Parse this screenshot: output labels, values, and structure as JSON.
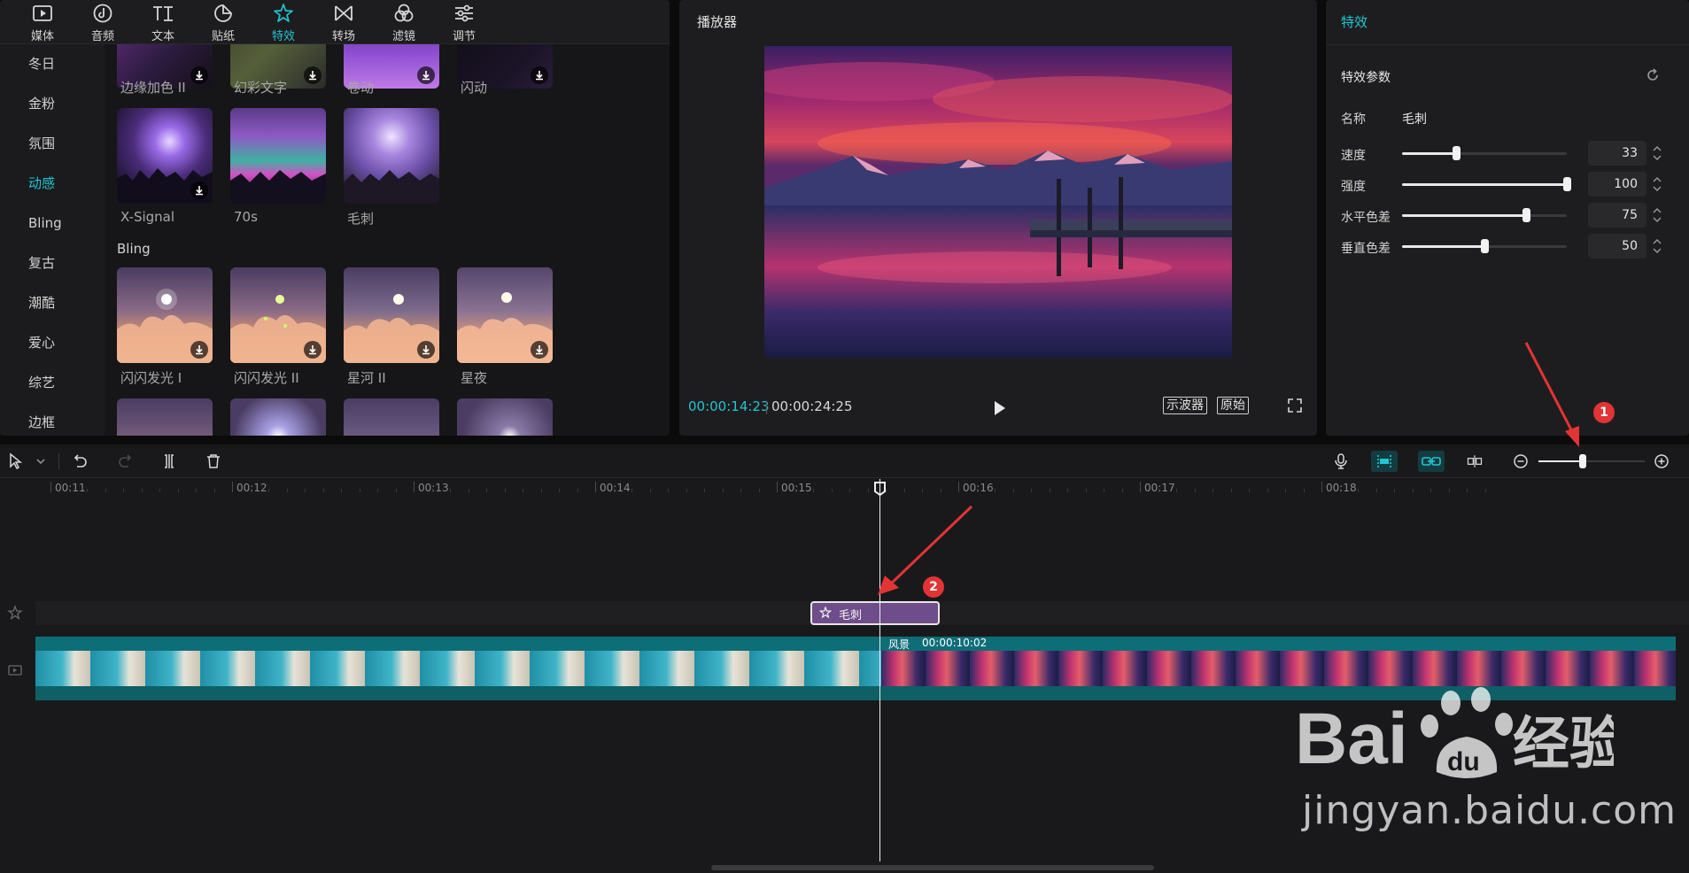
{
  "tabs": [
    {
      "label": "媒体",
      "icon": "media-icon",
      "active": false
    },
    {
      "label": "音频",
      "icon": "audio-icon",
      "active": false
    },
    {
      "label": "文本",
      "icon": "text-icon",
      "active": false
    },
    {
      "label": "贴纸",
      "icon": "sticker-icon",
      "active": false
    },
    {
      "label": "特效",
      "icon": "effects-icon",
      "active": true
    },
    {
      "label": "转场",
      "icon": "transition-icon",
      "active": false
    },
    {
      "label": "滤镜",
      "icon": "filter-icon",
      "active": false
    },
    {
      "label": "调节",
      "icon": "adjust-icon",
      "active": false
    }
  ],
  "categories": [
    "冬日",
    "金粉",
    "氛围",
    "动感",
    "Bling",
    "复古",
    "潮酷",
    "爱心",
    "综艺",
    "边框"
  ],
  "active_category": "动感",
  "effects_row1": [
    "边缘加色 II",
    "幻彩文字",
    "卷动",
    "闪动"
  ],
  "effects_row2": [
    "X-Signal",
    "70s",
    "毛刺"
  ],
  "section_bling": "Bling",
  "effects_bling": [
    "闪闪发光 I",
    "闪闪发光 II",
    "星河 II",
    "星夜"
  ],
  "player": {
    "title": "播放器",
    "current_time": "00:00:14:23",
    "total_time": "00:00:24:25",
    "scope_btn": "示波器",
    "original_btn": "原始"
  },
  "props": {
    "title": "特效",
    "section": "特效参数",
    "name_label": "名称",
    "name_value": "毛刺",
    "params": [
      {
        "label": "速度",
        "value": "33",
        "level": 0.33
      },
      {
        "label": "强度",
        "value": "100",
        "level": 1.0
      },
      {
        "label": "水平色差",
        "value": "75",
        "level": 0.75
      },
      {
        "label": "垂直色差",
        "value": "50",
        "level": 0.5
      }
    ]
  },
  "timeline": {
    "ruler": [
      "00:11",
      "00:12",
      "00:13",
      "00:14",
      "00:15",
      "00:16",
      "00:17",
      "00:18"
    ],
    "effect_clip": "毛刺",
    "clip_name": "风景",
    "clip_duration": "00:00:10:02",
    "zoom_level": 0.42
  },
  "annotations": [
    "1",
    "2"
  ],
  "watermark": {
    "brand": "Bai du 经验",
    "url": "jingyan.baidu.com"
  },
  "colors": {
    "accent": "#22c5d1",
    "clip_fx": "#6f4c8a",
    "clip_head": "#0e6e78",
    "badge": "#e23434"
  }
}
